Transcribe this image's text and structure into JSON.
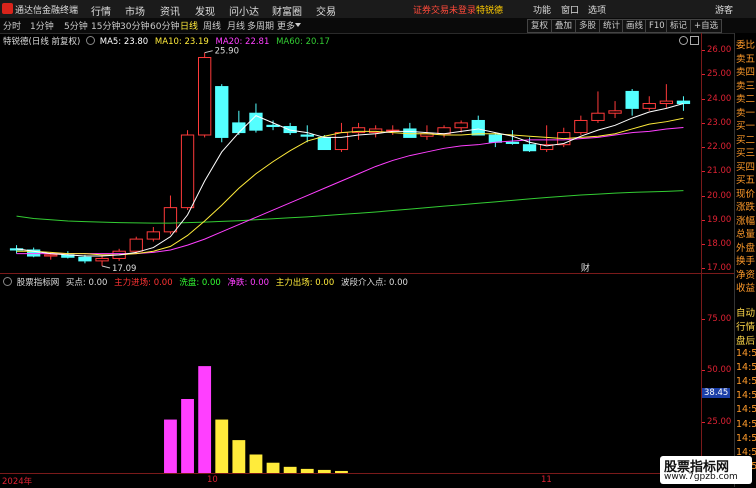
{
  "app": {
    "title": "通达信金融终端"
  },
  "menu": [
    "行情",
    "市场",
    "资讯",
    "发现",
    "问小达",
    "财富圈",
    "交易"
  ],
  "notice": {
    "text": "证券交易未登录",
    "stock": "特锐德"
  },
  "top_right": [
    "功能",
    "窗口",
    "选项",
    "游客"
  ],
  "periods": [
    "分时",
    "1分钟",
    "5分钟",
    "15分钟",
    "30分钟",
    "60分钟",
    "日线",
    "周线",
    "月线",
    "多周期",
    "更多"
  ],
  "active_period": "日线",
  "toolbar_right": [
    "复权",
    "叠加",
    "多股",
    "统计",
    "画线",
    "F10",
    "标记",
    "+自选"
  ],
  "main": {
    "stock_label": "特锐德(日线 前复权)",
    "ma": [
      {
        "label": "MA5: 23.80",
        "color": "#ffffff"
      },
      {
        "label": "MA10: 23.19",
        "color": "#ffeb3b"
      },
      {
        "label": "MA20: 22.81",
        "color": "#ff3fff"
      },
      {
        "label": "MA60: 20.17",
        "color": "#33cc33"
      }
    ],
    "high_marker": "25.90",
    "low_marker": "17.09",
    "cai_marker": "财",
    "axis": [
      "26.00",
      "25.00",
      "24.00",
      "23.00",
      "22.00",
      "21.00",
      "20.00",
      "19.00",
      "18.00",
      "17.00"
    ]
  },
  "sub": {
    "title": "股票指标网",
    "legend": [
      {
        "label": "买点: 0.00",
        "color": "#dddddd"
      },
      {
        "label": "主力进场: 0.00",
        "color": "#ff3333"
      },
      {
        "label": "洗盘: 0.00",
        "color": "#33ff33"
      },
      {
        "label": "净跌: 0.00",
        "color": "#ff3fff"
      },
      {
        "label": "主力出场: 0.00",
        "color": "#ffeb3b"
      },
      {
        "label": "波段介入点: 0.00",
        "color": "#dddddd"
      }
    ],
    "axis": [
      "75.00",
      "50.00",
      "25.00"
    ],
    "current_value": "38.45"
  },
  "x_labels": [
    "2024年",
    "10",
    "11"
  ],
  "right_panel": {
    "items_top": [
      "委比",
      "卖五",
      "卖四",
      "卖三",
      "卖二",
      "卖一",
      "买一",
      "买二",
      "买三",
      "买四",
      "买五",
      "现价",
      "涨跌",
      "涨幅",
      "总量",
      "外盘",
      "换手",
      "净资",
      "收益"
    ],
    "items_bottom": [
      "自动",
      "行情",
      "盘后",
      "14:5",
      "14:5",
      "14:5",
      "14:5",
      "14:5",
      "14:5",
      "14:5",
      "14:5",
      "14:5"
    ]
  },
  "watermark": {
    "line1": "股票指标网",
    "line2": "www.7gpzb.com"
  },
  "chart_data": {
    "type": "candlestick",
    "candles": [
      {
        "o": 17.8,
        "h": 17.95,
        "l": 17.6,
        "c": 17.75
      },
      {
        "o": 17.75,
        "h": 17.85,
        "l": 17.45,
        "c": 17.5
      },
      {
        "o": 17.5,
        "h": 17.65,
        "l": 17.35,
        "c": 17.55
      },
      {
        "o": 17.55,
        "h": 17.7,
        "l": 17.4,
        "c": 17.45
      },
      {
        "o": 17.45,
        "h": 17.55,
        "l": 17.2,
        "c": 17.3
      },
      {
        "o": 17.3,
        "h": 17.5,
        "l": 17.09,
        "c": 17.4
      },
      {
        "o": 17.4,
        "h": 17.8,
        "l": 17.3,
        "c": 17.7
      },
      {
        "o": 17.7,
        "h": 18.3,
        "l": 17.6,
        "c": 18.2
      },
      {
        "o": 18.2,
        "h": 18.7,
        "l": 18.1,
        "c": 18.5
      },
      {
        "o": 18.5,
        "h": 20.0,
        "l": 18.4,
        "c": 19.5
      },
      {
        "o": 19.5,
        "h": 22.7,
        "l": 19.4,
        "c": 22.5
      },
      {
        "o": 22.5,
        "h": 25.9,
        "l": 22.4,
        "c": 25.7
      },
      {
        "o": 24.5,
        "h": 24.6,
        "l": 22.2,
        "c": 22.4
      },
      {
        "o": 23.0,
        "h": 23.5,
        "l": 22.5,
        "c": 22.6
      },
      {
        "o": 23.4,
        "h": 23.8,
        "l": 22.6,
        "c": 22.7
      },
      {
        "o": 22.9,
        "h": 23.1,
        "l": 22.7,
        "c": 22.85
      },
      {
        "o": 22.85,
        "h": 23.0,
        "l": 22.5,
        "c": 22.6
      },
      {
        "o": 22.5,
        "h": 22.9,
        "l": 22.2,
        "c": 22.45
      },
      {
        "o": 22.4,
        "h": 22.5,
        "l": 21.9,
        "c": 21.9
      },
      {
        "o": 21.9,
        "h": 23.0,
        "l": 21.8,
        "c": 22.6
      },
      {
        "o": 22.6,
        "h": 23.0,
        "l": 22.3,
        "c": 22.8
      },
      {
        "o": 22.6,
        "h": 22.9,
        "l": 22.4,
        "c": 22.75
      },
      {
        "o": 22.7,
        "h": 22.9,
        "l": 22.5,
        "c": 22.7
      },
      {
        "o": 22.75,
        "h": 23.0,
        "l": 22.4,
        "c": 22.4
      },
      {
        "o": 22.45,
        "h": 22.9,
        "l": 22.3,
        "c": 22.55
      },
      {
        "o": 22.55,
        "h": 22.9,
        "l": 22.4,
        "c": 22.8
      },
      {
        "o": 22.8,
        "h": 23.1,
        "l": 22.6,
        "c": 23.0
      },
      {
        "o": 23.1,
        "h": 23.3,
        "l": 22.5,
        "c": 22.5
      },
      {
        "o": 22.5,
        "h": 22.6,
        "l": 22.0,
        "c": 22.2
      },
      {
        "o": 22.2,
        "h": 22.7,
        "l": 22.1,
        "c": 22.15
      },
      {
        "o": 22.1,
        "h": 22.4,
        "l": 21.8,
        "c": 21.85
      },
      {
        "o": 21.9,
        "h": 22.9,
        "l": 21.8,
        "c": 22.1
      },
      {
        "o": 22.1,
        "h": 22.8,
        "l": 22.0,
        "c": 22.6
      },
      {
        "o": 22.6,
        "h": 23.3,
        "l": 22.5,
        "c": 23.1
      },
      {
        "o": 23.1,
        "h": 24.3,
        "l": 23.0,
        "c": 23.4
      },
      {
        "o": 23.4,
        "h": 23.9,
        "l": 23.2,
        "c": 23.5
      },
      {
        "o": 24.3,
        "h": 24.4,
        "l": 23.3,
        "c": 23.6
      },
      {
        "o": 23.6,
        "h": 24.1,
        "l": 23.5,
        "c": 23.8
      },
      {
        "o": 23.8,
        "h": 24.6,
        "l": 23.6,
        "c": 23.9
      },
      {
        "o": 23.9,
        "h": 24.1,
        "l": 23.5,
        "c": 23.8
      }
    ],
    "ma5": [
      17.8,
      17.7,
      17.6,
      17.55,
      17.5,
      17.5,
      17.55,
      17.65,
      17.85,
      18.3,
      19.2,
      20.6,
      21.8,
      22.6,
      23.3,
      23.0,
      22.7,
      22.6,
      22.4,
      22.4,
      22.5,
      22.55,
      22.65,
      22.65,
      22.6,
      22.55,
      22.65,
      22.75,
      22.6,
      22.45,
      22.2,
      22.05,
      22.15,
      22.45,
      22.7,
      22.9,
      23.2,
      23.45,
      23.6,
      23.8
    ],
    "ma10": [
      17.7,
      17.7,
      17.65,
      17.6,
      17.6,
      17.55,
      17.55,
      17.6,
      17.7,
      17.9,
      18.35,
      18.95,
      19.6,
      20.3,
      20.9,
      21.4,
      21.85,
      22.25,
      22.45,
      22.6,
      22.65,
      22.65,
      22.6,
      22.55,
      22.55,
      22.5,
      22.5,
      22.55,
      22.55,
      22.5,
      22.45,
      22.4,
      22.35,
      22.4,
      22.45,
      22.55,
      22.75,
      22.95,
      23.05,
      23.19
    ],
    "ma20": [
      17.6,
      17.6,
      17.6,
      17.6,
      17.6,
      17.6,
      17.6,
      17.6,
      17.65,
      17.75,
      17.95,
      18.2,
      18.5,
      18.8,
      19.1,
      19.4,
      19.7,
      20.0,
      20.3,
      20.6,
      20.9,
      21.2,
      21.45,
      21.65,
      21.8,
      21.95,
      22.05,
      22.1,
      22.2,
      22.25,
      22.3,
      22.3,
      22.3,
      22.35,
      22.4,
      22.5,
      22.6,
      22.65,
      22.75,
      22.81
    ],
    "ma60": [
      19.15,
      19.05,
      19.0,
      18.95,
      18.92,
      18.9,
      18.88,
      18.87,
      18.86,
      18.86,
      18.88,
      18.9,
      18.93,
      18.96,
      19.0,
      19.04,
      19.08,
      19.12,
      19.17,
      19.22,
      19.27,
      19.32,
      19.38,
      19.44,
      19.5,
      19.56,
      19.62,
      19.68,
      19.74,
      19.8,
      19.86,
      19.92,
      19.97,
      20.02,
      20.06,
      20.1,
      20.13,
      20.15,
      20.17,
      20.2
    ],
    "sub_bars": [
      {
        "i": 9,
        "v": 26,
        "c": "#ff3fff"
      },
      {
        "i": 10,
        "v": 36,
        "c": "#ff3fff"
      },
      {
        "i": 11,
        "v": 52,
        "c": "#ff3fff"
      },
      {
        "i": 12,
        "v": 26,
        "c": "#ffeb3b"
      },
      {
        "i": 13,
        "v": 16,
        "c": "#ffeb3b"
      },
      {
        "i": 14,
        "v": 9,
        "c": "#ffeb3b"
      },
      {
        "i": 15,
        "v": 5,
        "c": "#ffeb3b"
      },
      {
        "i": 16,
        "v": 3,
        "c": "#ffeb3b"
      },
      {
        "i": 17,
        "v": 2,
        "c": "#ffeb3b"
      },
      {
        "i": 18,
        "v": 1.5,
        "c": "#ffeb3b"
      },
      {
        "i": 19,
        "v": 1,
        "c": "#ffeb3b"
      }
    ],
    "ylim": [
      16.8,
      26.3
    ],
    "sub_ylim": [
      0,
      90
    ]
  }
}
